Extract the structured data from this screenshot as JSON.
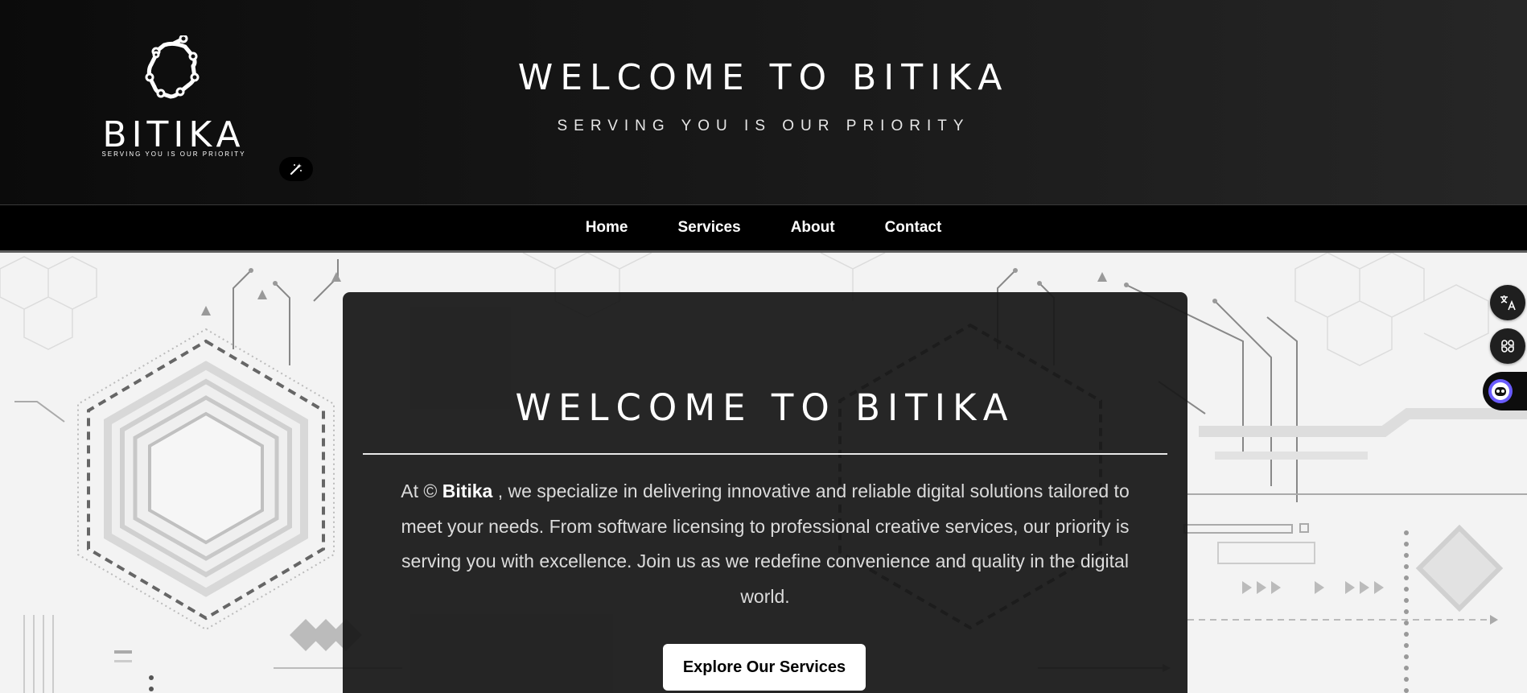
{
  "header": {
    "logo_text": "BITIKA",
    "logo_tagline": "SERVING YOU IS OUR PRIORITY",
    "title": "WELCOME TO BITIKA",
    "subtitle": "SERVING YOU IS OUR PRIORITY"
  },
  "nav": {
    "items": [
      "Home",
      "Services",
      "About",
      "Contact"
    ]
  },
  "hero": {
    "title": "WELCOME TO BITIKA",
    "intro_pre": "At © ",
    "brand": "Bitika",
    "intro_post": " , we specialize in delivering innovative and reliable digital solutions tailored to meet your needs. From software licensing to professional creative services, our priority is serving you with excellence. Join us as we redefine convenience and quality in the digital world.",
    "cta_label": "Explore Our Services"
  },
  "side_buttons": {
    "translate": "translate-icon",
    "apps": "apps-icon",
    "assistant": "assistant-icon"
  },
  "colors": {
    "header_bg": "#111111",
    "nav_bg": "#000000",
    "card_bg": "#181818",
    "text": "#ffffff"
  }
}
